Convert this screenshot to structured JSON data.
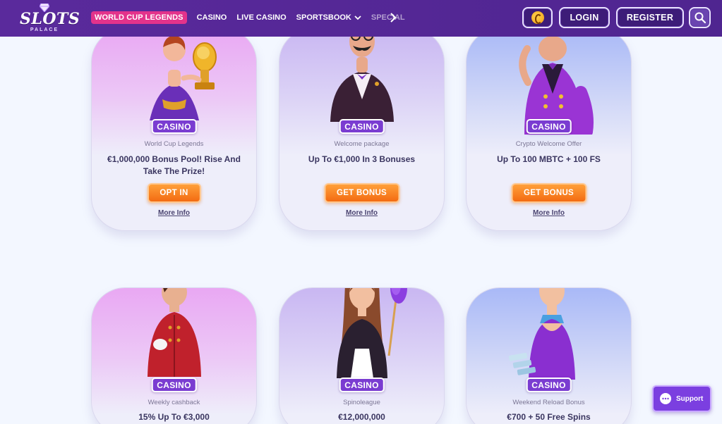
{
  "brand": {
    "logo_word": "SLOTS",
    "logo_sub": "PALACE"
  },
  "nav": {
    "items": [
      {
        "label": "WORLD CUP LEGENDS",
        "highlighted": true
      },
      {
        "label": "CASINO"
      },
      {
        "label": "LIVE CASINO"
      },
      {
        "label": "SPORTSBOOK",
        "has_dropdown": true
      },
      {
        "label": "SPECIAL"
      }
    ],
    "next_icon": "chevron-right-icon"
  },
  "header_buttons": {
    "coin_icon": "coin-icon",
    "login": "LOGIN",
    "register": "REGISTER",
    "search_icon": "search-icon"
  },
  "cards": [
    {
      "badge": "CASINO",
      "subtitle": "World Cup Legends",
      "title": "€1,000,000 Bonus Pool! Rise And Take The Prize!",
      "cta": "OPT IN",
      "more": "More Info"
    },
    {
      "badge": "CASINO",
      "subtitle": "Welcome package",
      "title": "Up To €1,000 In 3 Bonuses",
      "cta": "GET BONUS",
      "more": "More Info"
    },
    {
      "badge": "CASINO",
      "subtitle": "Crypto Welcome Offer",
      "title": "Up To 100 MBTC + 100 FS",
      "cta": "GET BONUS",
      "more": "More Info"
    },
    {
      "badge": "CASINO",
      "subtitle": "Weekly cashback",
      "title": "15% Up To €3,000"
    },
    {
      "badge": "CASINO",
      "subtitle": "Spinoleague",
      "title": "€12,000,000"
    },
    {
      "badge": "CASINO",
      "subtitle": "Weekend Reload Bonus",
      "title": "€700 + 50 Free Spins"
    }
  ],
  "support": {
    "label": "Support",
    "icon": "chat-bubble-icon"
  },
  "colors": {
    "header": "#5a2a9c",
    "nav_highlight": "#e3338b",
    "badge": "#7a3cd1",
    "cta": "#f36b12",
    "support": "#7b3fe0"
  }
}
